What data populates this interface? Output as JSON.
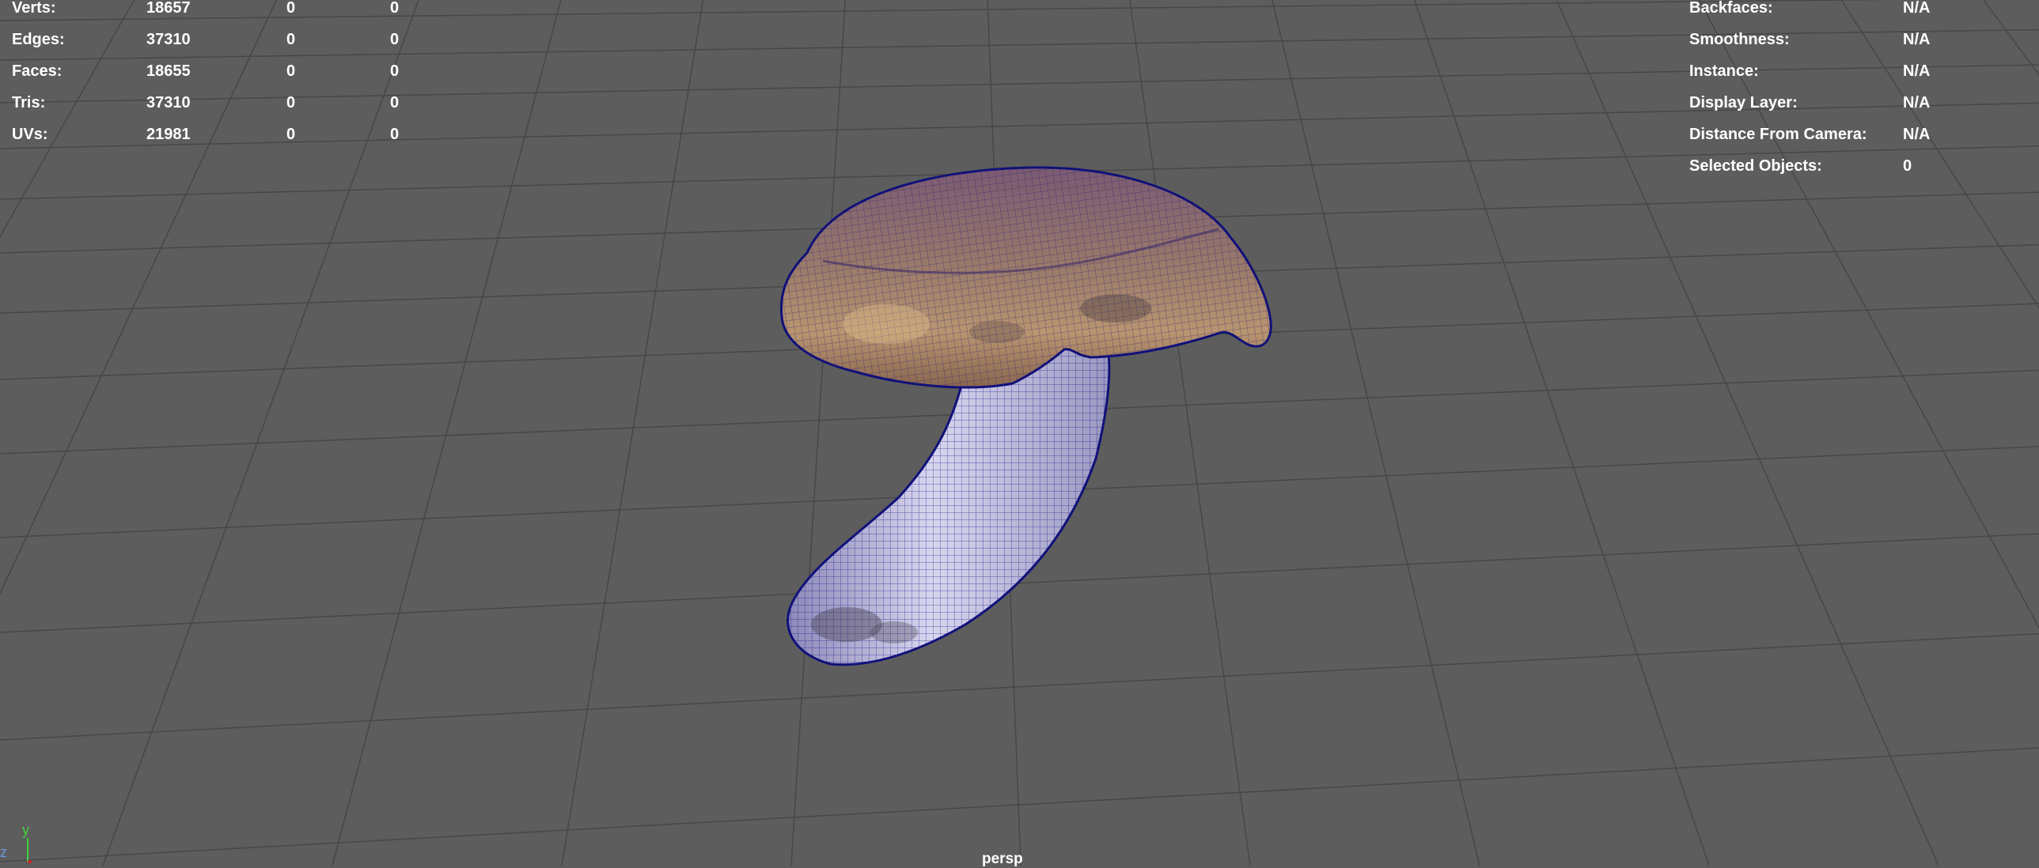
{
  "poly_count": {
    "rows": [
      {
        "label": "Verts:",
        "value": "18657",
        "col2": "0",
        "col3": "0"
      },
      {
        "label": "Edges:",
        "value": "37310",
        "col2": "0",
        "col3": "0"
      },
      {
        "label": "Faces:",
        "value": "18655",
        "col2": "0",
        "col3": "0"
      },
      {
        "label": "Tris:",
        "value": "37310",
        "col2": "0",
        "col3": "0"
      },
      {
        "label": "UVs:",
        "value": "21981",
        "col2": "0",
        "col3": "0"
      }
    ]
  },
  "object_info": {
    "rows": [
      {
        "label": "Backfaces:",
        "value": "N/A"
      },
      {
        "label": "Smoothness:",
        "value": "N/A"
      },
      {
        "label": "Instance:",
        "value": "N/A"
      },
      {
        "label": "Display Layer:",
        "value": "N/A"
      },
      {
        "label": "Distance From Camera:",
        "value": "N/A"
      },
      {
        "label": "Selected Objects:",
        "value": "0"
      }
    ]
  },
  "viewport": {
    "camera": "persp",
    "background_color": "#5d5d5d",
    "grid_color": "#454545",
    "wireframe_color": "#1a1aa0"
  },
  "axis_gizmo": {
    "y_label": "y",
    "z_label": "z",
    "y_color": "#3fd13f",
    "x_color": "#e02020"
  }
}
